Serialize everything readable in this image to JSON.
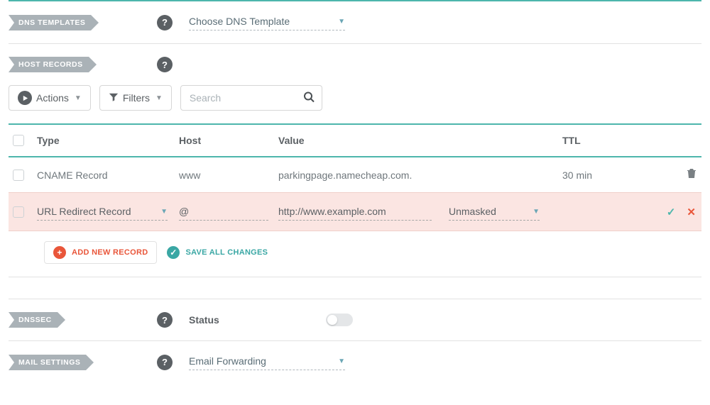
{
  "sections": {
    "dns_templates": {
      "tag": "DNS TEMPLATES",
      "select_label": "Choose DNS Template"
    },
    "host_records": {
      "tag": "HOST RECORDS"
    },
    "dnssec": {
      "tag": "DNSSEC",
      "status_label": "Status"
    },
    "mail_settings": {
      "tag": "MAIL SETTINGS",
      "select_label": "Email Forwarding"
    }
  },
  "toolbar": {
    "actions_label": "Actions",
    "filters_label": "Filters",
    "search_placeholder": "Search"
  },
  "table": {
    "headers": {
      "type": "Type",
      "host": "Host",
      "value": "Value",
      "ttl": "TTL"
    },
    "rows": [
      {
        "type": "CNAME Record",
        "host": "www",
        "value": "parkingpage.namecheap.com.",
        "ttl": "30 min"
      }
    ],
    "edit_row": {
      "type": "URL Redirect Record",
      "host": "@",
      "value": "http://www.example.com",
      "mask": "Unmasked"
    }
  },
  "actions": {
    "add_new_record": "ADD NEW RECORD",
    "save_all": "SAVE ALL CHANGES"
  }
}
